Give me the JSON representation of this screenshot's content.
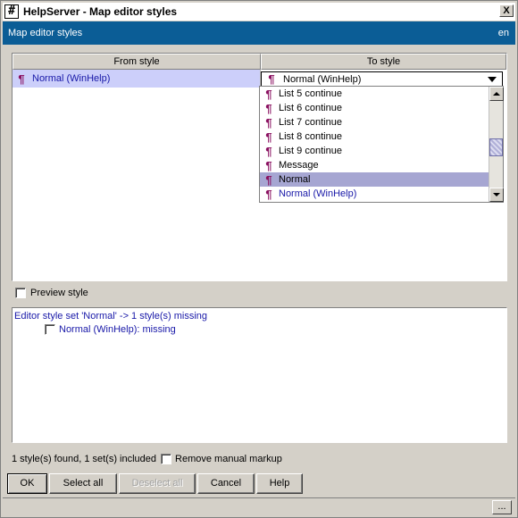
{
  "window": {
    "title": "HelpServer - Map editor styles",
    "app_icon_glyph": "#",
    "close_glyph": "X"
  },
  "header": {
    "title": "Map editor styles",
    "lang": "en",
    "bg_color": "#0b5d96"
  },
  "table": {
    "columns": [
      "From style",
      "To style"
    ],
    "row": {
      "from": "Normal (WinHelp)",
      "to": "Normal (WinHelp)"
    },
    "para_icon": "¶"
  },
  "dropdown": {
    "items": [
      {
        "label": "List 5 continue"
      },
      {
        "label": "List 6 continue"
      },
      {
        "label": "List 7 continue"
      },
      {
        "label": "List 8 continue"
      },
      {
        "label": "List 9 continue"
      },
      {
        "label": "Message"
      },
      {
        "label": "Normal",
        "selected": true
      },
      {
        "label": "Normal (WinHelp)"
      }
    ]
  },
  "preview": {
    "label": "Preview style",
    "checked": false
  },
  "messages": {
    "line1": "Editor style set 'Normal' -> 1 style(s) missing",
    "line2": "Normal (WinHelp): missing"
  },
  "status": {
    "text": "1 style(s) found, 1 set(s) included",
    "remove_markup_label": "Remove manual markup"
  },
  "buttons": {
    "ok": "OK",
    "select_all": "Select all",
    "deselect_all": "Deselect all",
    "cancel": "Cancel",
    "help": "Help"
  },
  "bottom": {
    "ellipsis": "..."
  }
}
